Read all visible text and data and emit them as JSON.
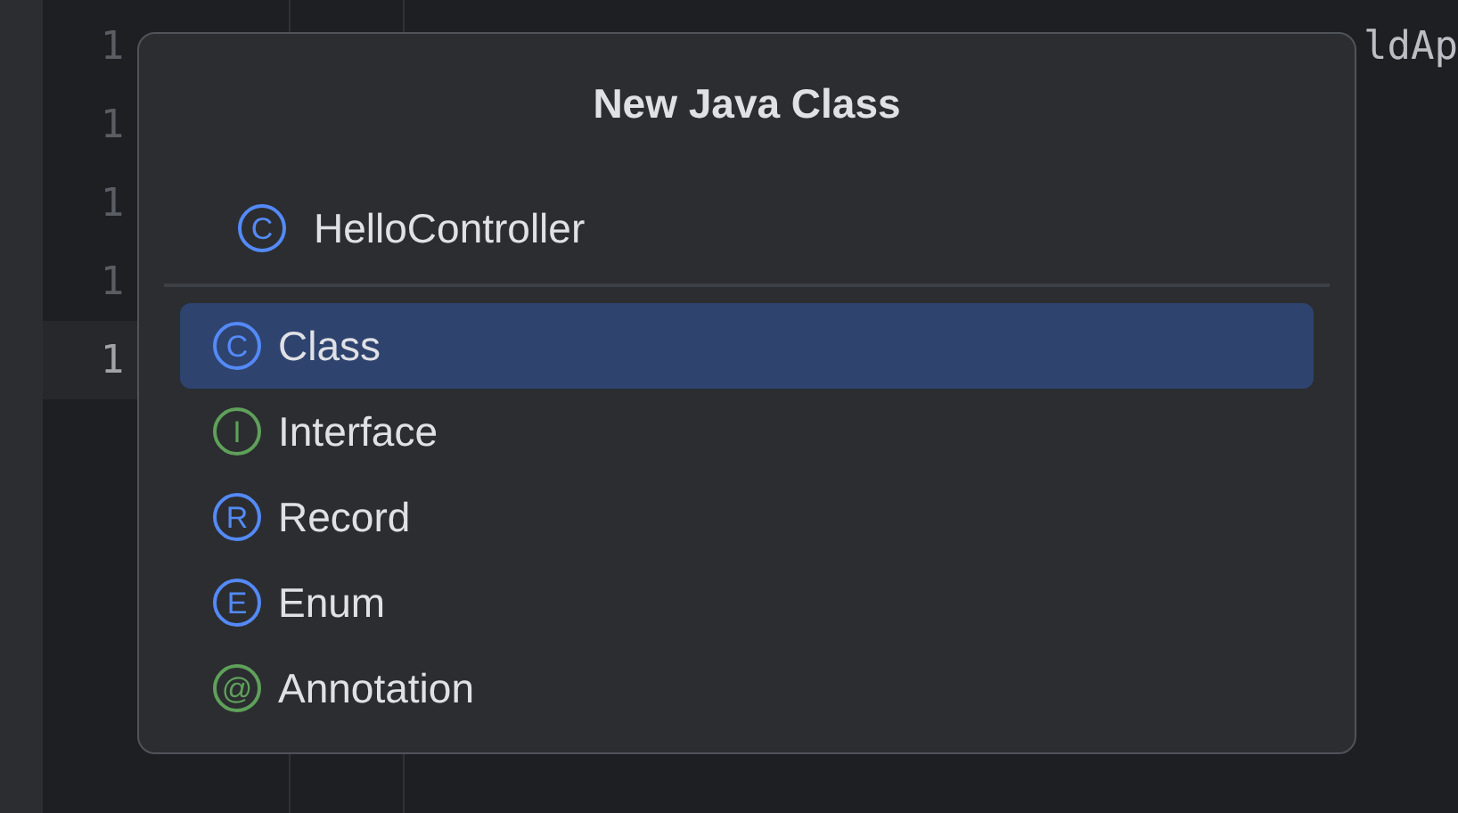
{
  "editor": {
    "line_numbers": [
      {
        "text": "1",
        "current": false
      },
      {
        "text": "1",
        "current": false
      },
      {
        "text": "1",
        "current": false
      },
      {
        "text": "1",
        "current": false
      },
      {
        "text": "1",
        "current": true
      }
    ],
    "code_fragment": "ldAp"
  },
  "dialog": {
    "title": "New Java Class",
    "name_field": {
      "icon_letter": "C",
      "color": "#548af7",
      "value": "HelloController"
    },
    "items": [
      {
        "icon_letter": "C",
        "color": "#548af7",
        "label": "Class",
        "selected": true
      },
      {
        "icon_letter": "I",
        "color": "#5fa05a",
        "label": "Interface",
        "selected": false
      },
      {
        "icon_letter": "R",
        "color": "#548af7",
        "label": "Record",
        "selected": false
      },
      {
        "icon_letter": "E",
        "color": "#548af7",
        "label": "Enum",
        "selected": false
      },
      {
        "icon_letter": "@",
        "color": "#5fa05a",
        "label": "Annotation",
        "selected": false
      }
    ]
  }
}
